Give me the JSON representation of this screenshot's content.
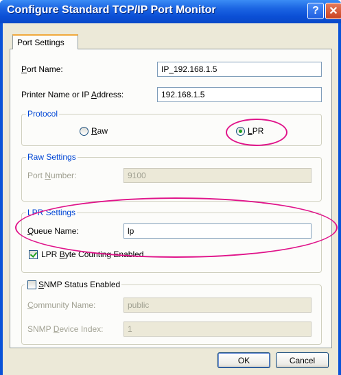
{
  "window": {
    "title": "Configure Standard TCP/IP Port Monitor",
    "help_glyph": "?",
    "close_glyph": "✕"
  },
  "tab": {
    "label": "Port Settings"
  },
  "port_name": {
    "label_pre": "",
    "label_mn": "P",
    "label_post": "ort Name:",
    "value": "IP_192.168.1.5"
  },
  "printer_address": {
    "label_pre": "Printer Name or IP ",
    "label_mn": "A",
    "label_post": "ddress:",
    "value": "192.168.1.5"
  },
  "protocol": {
    "legend": "Protocol",
    "raw": {
      "mn": "R",
      "rest": "aw",
      "selected": false
    },
    "lpr": {
      "mn": "L",
      "rest": "PR",
      "selected": true
    }
  },
  "raw_settings": {
    "legend": "Raw Settings",
    "port_number": {
      "label_pre": "Port ",
      "label_mn": "N",
      "label_post": "umber:",
      "value": "9100"
    }
  },
  "lpr_settings": {
    "legend": "LPR Settings",
    "queue_name": {
      "label_mn": "Q",
      "label_post": "ueue Name:",
      "value": "lp"
    },
    "byte_counting": {
      "label_pre": "LPR ",
      "label_mn": "B",
      "label_post": "yte Counting Enabled",
      "checked": true
    }
  },
  "snmp": {
    "enabled": {
      "label_mn": "S",
      "label_post": "NMP Status Enabled",
      "checked": false
    },
    "community": {
      "label_pre": "",
      "label_mn": "C",
      "label_post": "ommunity Name:",
      "value": "public"
    },
    "device_index": {
      "label_pre": "SNMP ",
      "label_mn": "D",
      "label_post": "evice Index:",
      "value": "1"
    }
  },
  "buttons": {
    "ok": {
      "mn": "",
      "label": "OK"
    },
    "cancel": {
      "label": "Cancel"
    }
  },
  "colors": {
    "annotation": "#e0148a",
    "titlebar": "#0a53d8"
  }
}
